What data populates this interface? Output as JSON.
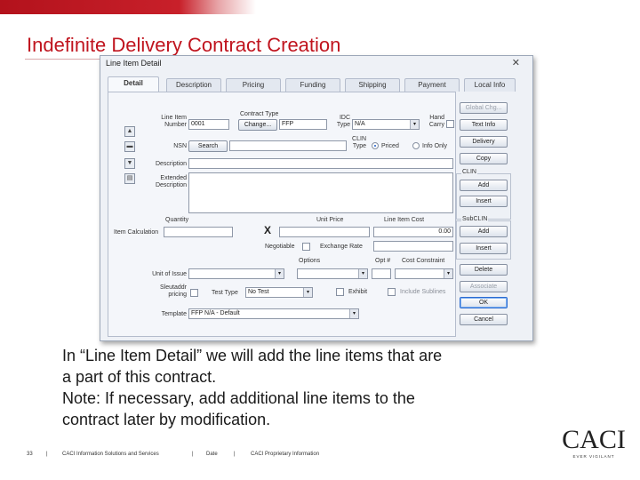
{
  "slide": {
    "title": "Indefinite Delivery Contract Creation",
    "caption_lines": [
      "In “Line Item Detail” we will add the line items that are",
      "a part of this contract.",
      "Note: If necessary, add additional line items to the",
      "contract later by modification."
    ],
    "footer": {
      "page": "33",
      "sep": "|",
      "company": "CACI Information Solutions and Services",
      "date": "Date",
      "proprietary": "CACI Proprietary Information"
    },
    "logo": {
      "name": "CACI",
      "tagline": "EVER VIGILANT"
    },
    "colors": {
      "title": "#c0141e",
      "topbar": "#b3121c"
    }
  },
  "dialog": {
    "title": "Line Item Detail",
    "close": "✕",
    "tabs": [
      "Detail",
      "Description",
      "Pricing",
      "Funding",
      "Shipping",
      "Payment",
      "Local Info"
    ],
    "fields": {
      "line_item_number_label": "Line Item\nNumber",
      "line_item_number_value": "0001",
      "contract_type_label": "Contract Type",
      "change_button": "Change...",
      "contract_type_value": "FFP",
      "idc_type_label": "IDC\nType",
      "idc_type_value": "N/A",
      "hand_carry_label": "Hand\nCarry",
      "nsn_label": "NSN",
      "search_button": "Search",
      "clin_type_label": "CLIN\nType",
      "clin_type_priced": "Priced",
      "clin_type_info": "Info Only",
      "description_label": "Description",
      "extended_description_label": "Extended\nDescription",
      "quantity_label": "Quantity",
      "item_calculation_label": "Item Calculation",
      "x_symbol": "X",
      "unit_price_label": "Unit Price",
      "line_item_cost_label": "Line Item Cost",
      "line_item_cost_value": "0.00",
      "negotiable_label": "Negotiable",
      "exchange_rate_label": "Exchange Rate",
      "options_label": "Options",
      "opt_num_label": "Opt #",
      "cost_constraint_label": "Cost Constraint",
      "unit_of_issue_label": "Unit of Issue",
      "sieutaddr_label": "Sleutaddr\npricing",
      "test_type_label": "Test Type",
      "test_type_value": "No Test",
      "exhibit_label": "Exhibit",
      "include_sublines_label": "Include Sublines",
      "template_label": "Template",
      "template_value": "FFP N/A - Default",
      "dropdown_glyph": "▾"
    },
    "side_icons": [
      "▲",
      "▬",
      "▼",
      "▤"
    ],
    "right_buttons": {
      "global_chg": "Global Chg...",
      "text_info": "Text Info",
      "delivery": "Delivery",
      "copy": "Copy",
      "clin_group": "CLIN",
      "clin_add": "Add",
      "clin_insert": "Insert",
      "subclin_group": "SubCLIN",
      "subclin_add": "Add",
      "subclin_insert": "Insert",
      "delete": "Delete",
      "associate": "Associate",
      "ok": "OK",
      "cancel": "Cancel"
    }
  }
}
